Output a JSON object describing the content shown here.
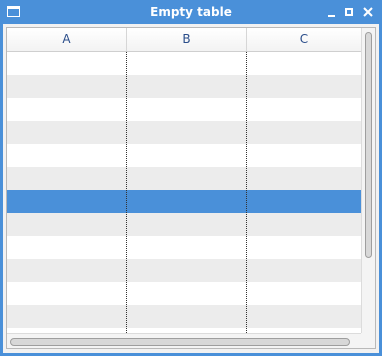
{
  "window": {
    "title": "Empty table",
    "icon": "window-icon",
    "controls": [
      "minimize-icon",
      "maximize-icon",
      "close-icon"
    ]
  },
  "table": {
    "columns": [
      "A",
      "B",
      "C"
    ],
    "row_count": 12,
    "selected_row": 6
  },
  "colors": {
    "accent": "#4a90d9",
    "row_alt": "#ececec"
  }
}
